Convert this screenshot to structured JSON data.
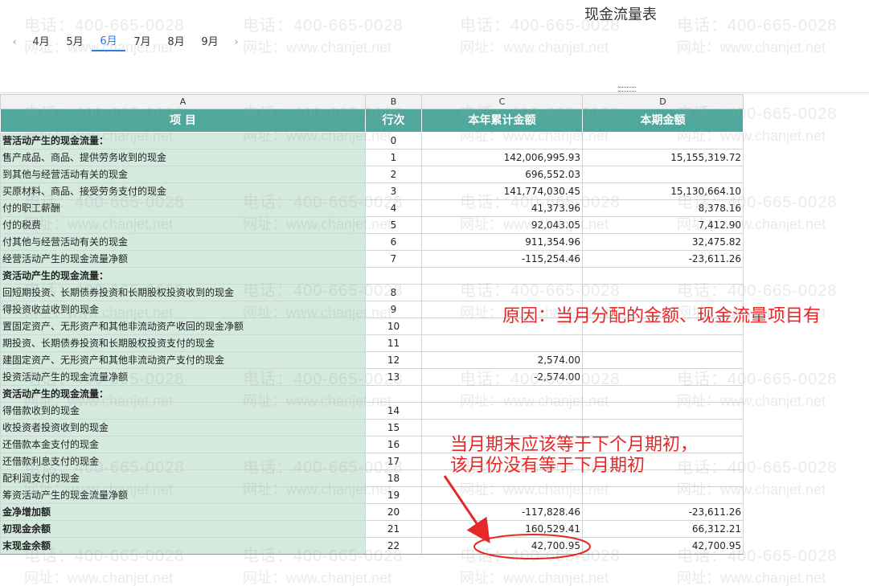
{
  "report": {
    "title": "现金流量表"
  },
  "month_nav": {
    "prev_icon": "‹",
    "next_icon": "›",
    "months": [
      "4月",
      "5月",
      "6月",
      "7月",
      "8月",
      "9月"
    ],
    "active_month": "6月"
  },
  "watermark": {
    "phone": "电话：400-665-0028",
    "site": "网址：www.chanjet.net"
  },
  "sheet": {
    "column_letters": [
      "A",
      "B",
      "C",
      "D"
    ],
    "headers": {
      "item": "项 目",
      "row_no": "行次",
      "ytd": "本年累计金额",
      "period": "本期金额"
    },
    "rows": [
      {
        "item": "营活动产生的现金流量：",
        "row": "0",
        "ytd": "",
        "period": "",
        "bold": true
      },
      {
        "item": "售产成品、商品、提供劳务收到的现金",
        "row": "1",
        "ytd": "142,006,995.93",
        "period": "15,155,319.72"
      },
      {
        "item": "到其他与经营活动有关的现金",
        "row": "2",
        "ytd": "696,552.03",
        "period": ""
      },
      {
        "item": "买原材料、商品、接受劳务支付的现金",
        "row": "3",
        "ytd": "141,774,030.45",
        "period": "15,130,664.10"
      },
      {
        "item": "付的职工薪酬",
        "row": "4",
        "ytd": "41,373.96",
        "period": "8,378.16"
      },
      {
        "item": "付的税费",
        "row": "5",
        "ytd": "92,043.05",
        "period": "7,412.90"
      },
      {
        "item": "付其他与经营活动有关的现金",
        "row": "6",
        "ytd": "911,354.96",
        "period": "32,475.82"
      },
      {
        "item": "经营活动产生的现金流量净额",
        "row": "7",
        "ytd": "-115,254.46",
        "period": "-23,611.26"
      },
      {
        "item": "资活动产生的现金流量：",
        "row": "",
        "ytd": "",
        "period": "",
        "bold": true
      },
      {
        "item": "回短期投资、长期债券投资和长期股权投资收到的现金",
        "row": "8",
        "ytd": "",
        "period": ""
      },
      {
        "item": "得投资收益收到的现金",
        "row": "9",
        "ytd": "",
        "period": ""
      },
      {
        "item": "置固定资产、无形资产和其他非流动资产收回的现金净额",
        "row": "10",
        "ytd": "",
        "period": ""
      },
      {
        "item": "期投资、长期债券投资和长期股权投资支付的现金",
        "row": "11",
        "ytd": "",
        "period": ""
      },
      {
        "item": "建固定资产、无形资产和其他非流动资产支付的现金",
        "row": "12",
        "ytd": "2,574.00",
        "period": ""
      },
      {
        "item": "投资活动产生的现金流量净额",
        "row": "13",
        "ytd": "-2,574.00",
        "period": ""
      },
      {
        "item": "资活动产生的现金流量：",
        "row": "",
        "ytd": "",
        "period": "",
        "bold": true
      },
      {
        "item": "得借款收到的现金",
        "row": "14",
        "ytd": "",
        "period": ""
      },
      {
        "item": "收投资者投资收到的现金",
        "row": "15",
        "ytd": "",
        "period": ""
      },
      {
        "item": "还借款本金支付的现金",
        "row": "16",
        "ytd": "",
        "period": ""
      },
      {
        "item": "还借款利息支付的现金",
        "row": "17",
        "ytd": "",
        "period": ""
      },
      {
        "item": "配利润支付的现金",
        "row": "18",
        "ytd": "",
        "period": ""
      },
      {
        "item": "筹资活动产生的现金流量净额",
        "row": "19",
        "ytd": "",
        "period": ""
      },
      {
        "item": "金净增加额",
        "row": "20",
        "ytd": "-117,828.46",
        "period": "-23,611.26",
        "bold": true
      },
      {
        "item": "初现金余额",
        "row": "21",
        "ytd": "160,529.41",
        "period": "66,312.21",
        "bold": true
      },
      {
        "item": "末现金余额",
        "row": "22",
        "ytd": "42,700.95",
        "period": "42,700.95",
        "bold": true
      }
    ]
  },
  "annotations": {
    "cause": "原因：当月分配的金额、现金流量项目有",
    "note_line1": "当月期末应该等于下个月期初，",
    "note_line2": "该月份没有等于下月期初",
    "color": "#e52828"
  }
}
